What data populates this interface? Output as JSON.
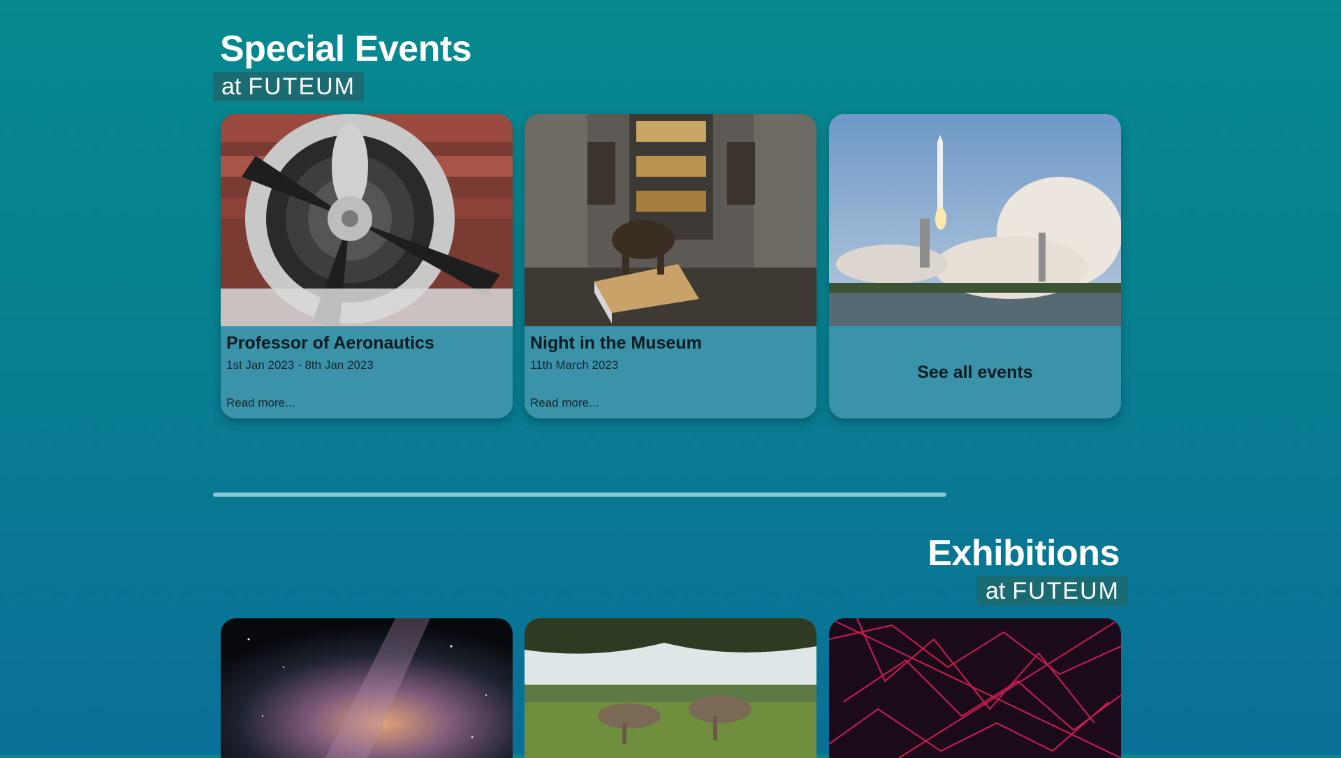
{
  "special_events": {
    "title": "Special Events",
    "brand_at": "at",
    "brand_name": "FUTEUM",
    "events": [
      {
        "title": "Professor of Aeronautics",
        "date": "1st Jan 2023 - 8th Jan 2023",
        "link": "Read more...",
        "image": "airplane-propeller-photo"
      },
      {
        "title": "Night in the Museum",
        "date": "11th March 2023",
        "link": "Read more...",
        "image": "museum-hall-elephant-photo"
      }
    ],
    "see_all": {
      "label": "See all events",
      "image": "rocket-launch-photo"
    }
  },
  "exhibitions": {
    "title": "Exhibitions",
    "brand_at": "at",
    "brand_name": "FUTEUM",
    "items": [
      {
        "image": "milky-way-night-sky-photo"
      },
      {
        "image": "dinosaurs-in-field-photo"
      },
      {
        "image": "pink-network-lines-art"
      }
    ]
  },
  "colors": {
    "background_top": "#07898f",
    "background_bottom": "#0a6f98",
    "card": "#3a93a8",
    "divider": "#8fc5d8",
    "brand_tag": "#1a6b72"
  }
}
